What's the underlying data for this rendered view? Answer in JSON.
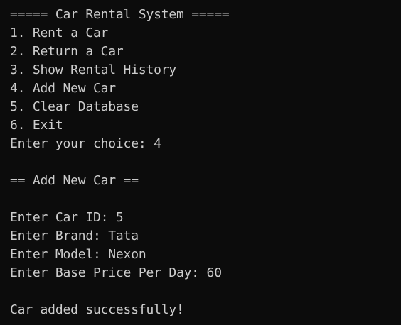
{
  "terminal": {
    "lines": [
      "===== Car Rental System =====",
      "1. Rent a Car",
      "2. Return a Car",
      "3. Show Rental History",
      "4. Add New Car",
      "5. Clear Database",
      "6. Exit",
      "Enter your choice: 4",
      "",
      "== Add New Car ==",
      "",
      "Enter Car ID: 5",
      "Enter Brand: Tata",
      "Enter Model: Nexon",
      "Enter Base Price Per Day: 60",
      "",
      "Car added successfully!"
    ]
  }
}
